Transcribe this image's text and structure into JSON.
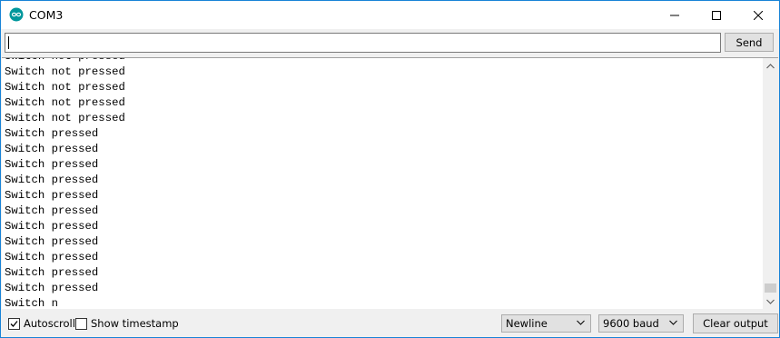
{
  "window": {
    "title": "COM3",
    "accent_color": "#1883d7",
    "icon": "arduino-icon"
  },
  "send_bar": {
    "input_value": "",
    "send_label": "Send"
  },
  "output": {
    "partial_top_line": "Switch not pressed",
    "lines": [
      "Switch not pressed",
      "Switch not pressed",
      "Switch not pressed",
      "Switch not pressed",
      "Switch pressed",
      "Switch pressed",
      "Switch pressed",
      "Switch pressed",
      "Switch pressed",
      "Switch pressed",
      "Switch pressed",
      "Switch pressed",
      "Switch pressed",
      "Switch pressed",
      "Switch pressed",
      "Switch n"
    ]
  },
  "bottom_bar": {
    "autoscroll": {
      "label": "Autoscroll",
      "checked": true
    },
    "timestamp": {
      "label": "Show timestamp",
      "checked": false
    },
    "line_ending": "Newline",
    "baud_rate": "9600 baud",
    "clear_label": "Clear output"
  }
}
